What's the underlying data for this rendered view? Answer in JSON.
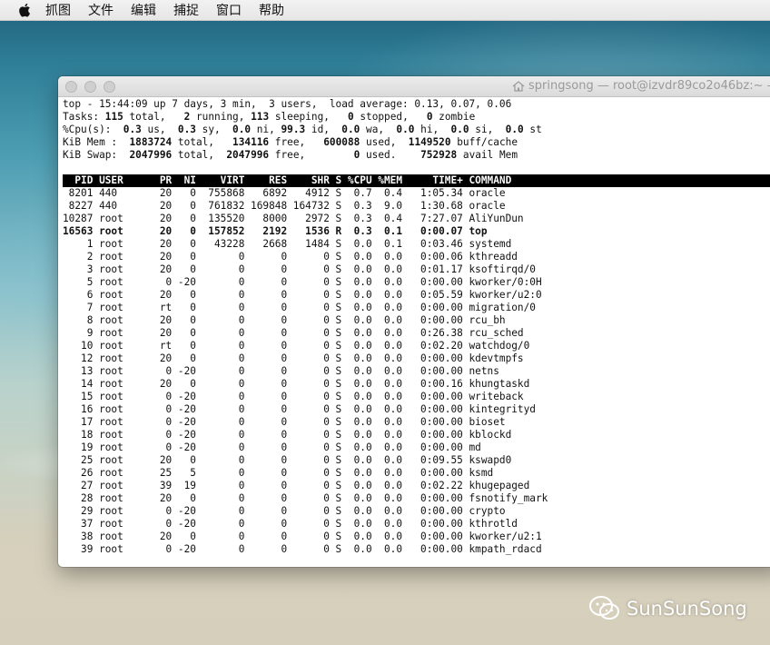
{
  "menubar": {
    "items": [
      "抓图",
      "文件",
      "编辑",
      "捕捉",
      "窗口",
      "帮助"
    ]
  },
  "window": {
    "title": "springsong — root@izvdr89co2o46bz:~ — s"
  },
  "summary": {
    "line1": "top - 15:44:09 up 7 days, 3 min,  3 users,  load average: 0.13, 0.07, 0.06",
    "tasks": {
      "label": "Tasks: ",
      "total": "115",
      "t_total": " total,   ",
      "running": "2",
      "t_running": " running, ",
      "sleeping": "113",
      "t_sleeping": " sleeping,   ",
      "stopped": "0",
      "t_stopped": " stopped,   ",
      "zombie": "0",
      "t_zombie": " zombie"
    },
    "cpu": {
      "label": "%Cpu(s):  ",
      "us": "0.3",
      "t_us": " us,  ",
      "sy": "0.3",
      "t_sy": " sy,  ",
      "ni": "0.0",
      "t_ni": " ni, ",
      "id": "99.3",
      "t_id": " id,  ",
      "wa": "0.0",
      "t_wa": " wa,  ",
      "hi": "0.0",
      "t_hi": " hi,  ",
      "si": "0.0",
      "t_si": " si,  ",
      "st": "0.0",
      "t_st": " st"
    },
    "mem": {
      "label": "KiB Mem : ",
      "total": " 1883724",
      "t_total": " total,  ",
      "free": " 134116",
      "t_free": " free,   ",
      "used": "600088",
      "t_used": " used,  ",
      "buff": "1149520",
      "t_buff": " buff/cache"
    },
    "swap": {
      "label": "KiB Swap: ",
      "total": " 2047996",
      "t_total": " total,  ",
      "free": "2047996",
      "t_free": " free,        ",
      "used": "0",
      "t_used": " used.   ",
      "avail": " 752928",
      "t_avail": " avail Mem"
    }
  },
  "process_table": {
    "header": "  PID USER      PR  NI    VIRT    RES    SHR S %CPU %MEM     TIME+ COMMAND",
    "rows": [
      " 8201 440       20   0  755868   6892   4912 S  0.7  0.4   1:05.34 oracle",
      " 8227 440       20   0  761832 169848 164732 S  0.3  9.0   1:30.68 oracle",
      "10287 root      20   0  135520   8000   2972 S  0.3  0.4   7:27.07 AliYunDun",
      "16563 root      20   0  157852   2192   1536 R  0.3  0.1   0:00.07 top",
      "    1 root      20   0   43228   2668   1484 S  0.0  0.1   0:03.46 systemd",
      "    2 root      20   0       0      0      0 S  0.0  0.0   0:00.06 kthreadd",
      "    3 root      20   0       0      0      0 S  0.0  0.0   0:01.17 ksoftirqd/0",
      "    5 root       0 -20       0      0      0 S  0.0  0.0   0:00.00 kworker/0:0H",
      "    6 root      20   0       0      0      0 S  0.0  0.0   0:05.59 kworker/u2:0",
      "    7 root      rt   0       0      0      0 S  0.0  0.0   0:00.00 migration/0",
      "    8 root      20   0       0      0      0 S  0.0  0.0   0:00.00 rcu_bh",
      "    9 root      20   0       0      0      0 S  0.0  0.0   0:26.38 rcu_sched",
      "   10 root      rt   0       0      0      0 S  0.0  0.0   0:02.20 watchdog/0",
      "   12 root      20   0       0      0      0 S  0.0  0.0   0:00.00 kdevtmpfs",
      "   13 root       0 -20       0      0      0 S  0.0  0.0   0:00.00 netns",
      "   14 root      20   0       0      0      0 S  0.0  0.0   0:00.16 khungtaskd",
      "   15 root       0 -20       0      0      0 S  0.0  0.0   0:00.00 writeback",
      "   16 root       0 -20       0      0      0 S  0.0  0.0   0:00.00 kintegrityd",
      "   17 root       0 -20       0      0      0 S  0.0  0.0   0:00.00 bioset",
      "   18 root       0 -20       0      0      0 S  0.0  0.0   0:00.00 kblockd",
      "   19 root       0 -20       0      0      0 S  0.0  0.0   0:00.00 md",
      "   25 root      20   0       0      0      0 S  0.0  0.0   0:09.55 kswapd0",
      "   26 root      25   5       0      0      0 S  0.0  0.0   0:00.00 ksmd",
      "   27 root      39  19       0      0      0 S  0.0  0.0   0:02.22 khugepaged",
      "   28 root      20   0       0      0      0 S  0.0  0.0   0:00.00 fsnotify_mark",
      "   29 root       0 -20       0      0      0 S  0.0  0.0   0:00.00 crypto",
      "   37 root       0 -20       0      0      0 S  0.0  0.0   0:00.00 kthrotld",
      "   38 root      20   0       0      0      0 S  0.0  0.0   0:00.00 kworker/u2:1",
      "   39 root       0 -20       0      0      0 S  0.0  0.0   0:00.00 kmpath_rdacd"
    ]
  },
  "watermark": {
    "text": "SunSunSong"
  }
}
